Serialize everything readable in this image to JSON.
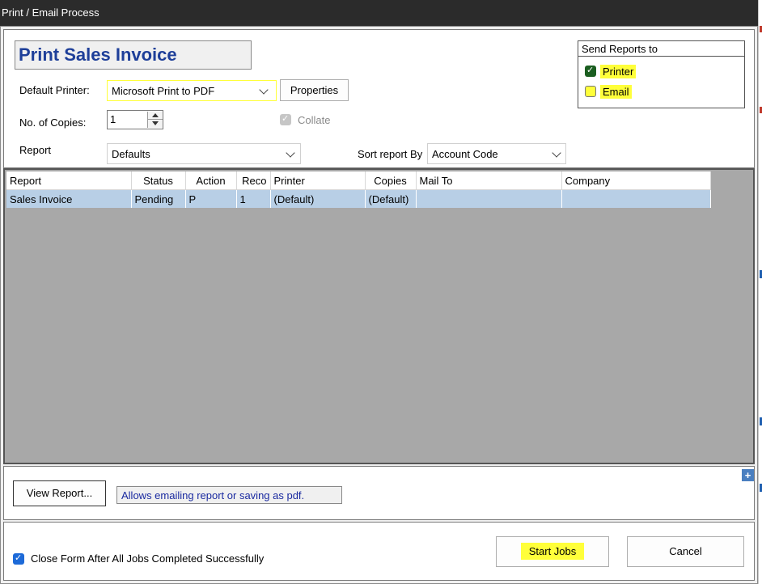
{
  "window": {
    "title": "Print / Email Process"
  },
  "header": {
    "title": "Print Sales Invoice"
  },
  "printer": {
    "label": "Default Printer:",
    "value": "Microsoft Print to PDF",
    "properties_label": "Properties"
  },
  "copies": {
    "label": "No. of Copies:",
    "value": "1",
    "collate_label": "Collate",
    "collate_checked": true
  },
  "report": {
    "label": "Report",
    "value": "Defaults",
    "sort_label": "Sort report By",
    "sort_value": "Account Code"
  },
  "send_to": {
    "title": "Send Reports to",
    "options": [
      {
        "label": "Printer",
        "checked": true
      },
      {
        "label": "Email",
        "checked": false
      }
    ]
  },
  "jobs_table": {
    "columns": [
      "Report",
      "Status",
      "Action",
      "Reco",
      "Printer",
      "Copies",
      "Mail To",
      "Company"
    ],
    "rows": [
      [
        "Sales Invoice",
        "Pending",
        "P",
        "1",
        "(Default)",
        "(Default)",
        "",
        ""
      ]
    ]
  },
  "preview": {
    "view_report_label": "View Report...",
    "hint": "Allows emailing report or saving as pdf."
  },
  "footer": {
    "close_form_label": "Close Form After All Jobs Completed Successfully",
    "close_form_checked": true,
    "start_jobs_label": "Start Jobs",
    "cancel_label": "Cancel"
  },
  "colors": {
    "accent": "#1e3f99",
    "highlight": "#ffff3a",
    "grid_bg": "#a8a8a8",
    "row_selected": "#b8cfe6"
  }
}
